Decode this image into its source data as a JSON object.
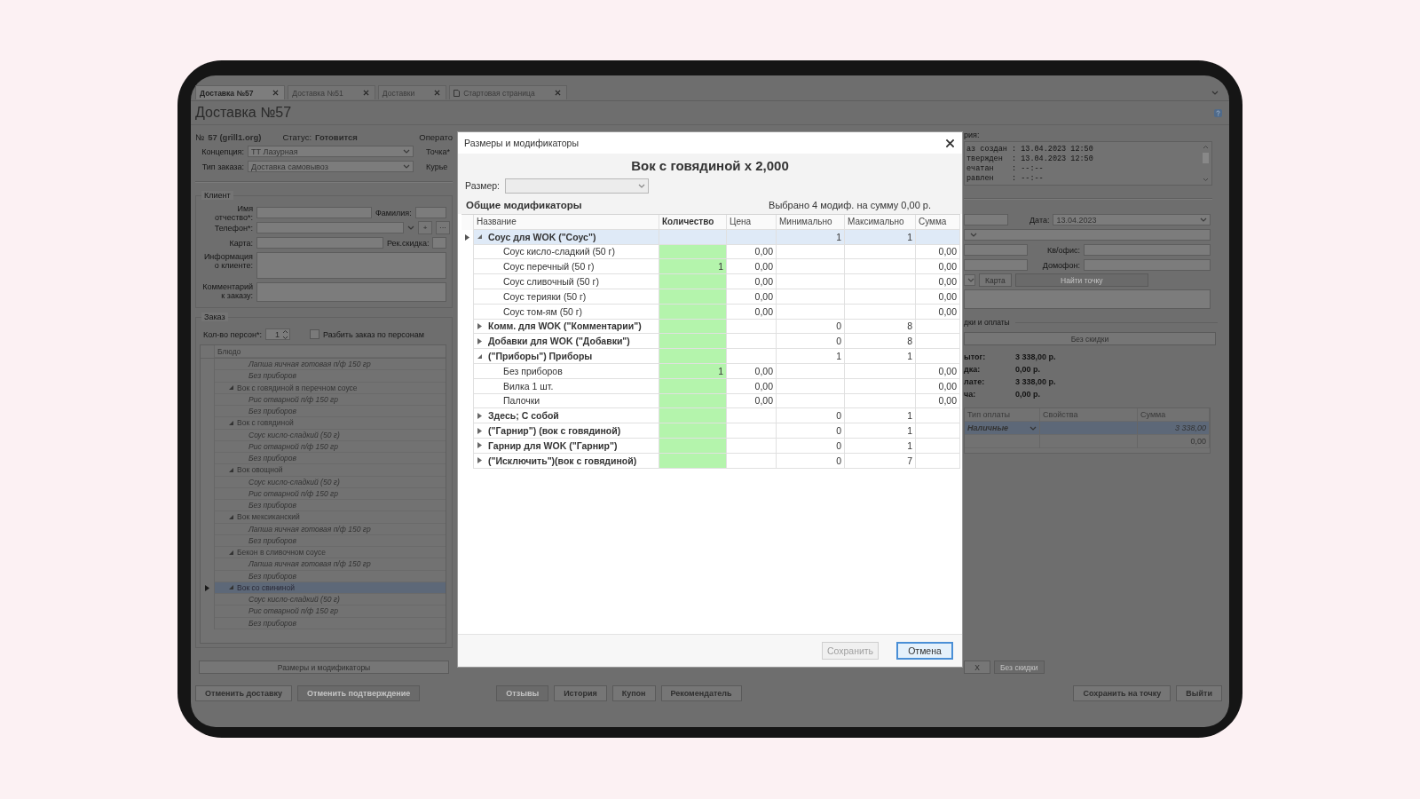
{
  "tabs": [
    {
      "label": "Доставка №57",
      "selected": true,
      "kind": "doc"
    },
    {
      "label": "Доставка №51",
      "selected": false,
      "kind": "doc"
    },
    {
      "label": "Доставки",
      "selected": false,
      "kind": "doc"
    },
    {
      "label": "Стартовая страница",
      "selected": false,
      "kind": "home"
    }
  ],
  "page_title": "Доставка №57",
  "order_header": {
    "number_prefix": "№",
    "number": "57 (grill1.org)",
    "status_label": "Статус:",
    "status": "Готовится",
    "operator_label": "Операто"
  },
  "order_fields": [
    {
      "label": "Концепция:",
      "value": "ТТ Лазурная",
      "side_label": "Точка*"
    },
    {
      "label": "Тип заказа:",
      "value": "Доставка самовывоз",
      "side_label": "Курье"
    }
  ],
  "client": {
    "title": "Клиент",
    "name_label": "Имя отчество*:",
    "surname_label": "Фамилия:",
    "phone_label": "Телефон*:",
    "phone_add": "+",
    "phone_more": "···",
    "card_label": "Карта:",
    "discount_label": "Рек.скидка:",
    "info_label": "Информация о клиенте:",
    "comment_label": "Комментарий к заказу:"
  },
  "order": {
    "title": "Заказ",
    "persons_label": "Кол-во персон*:",
    "persons": "1",
    "split_label": "Разбить заказ по персонам",
    "split_checked": false,
    "column": "Блюдо",
    "dishes": [
      {
        "kind": "modifier",
        "name": "Лапша яичная готовая п/ф 150 гр",
        "selected": false
      },
      {
        "kind": "modifier",
        "name": "Без приборов",
        "selected": false
      },
      {
        "kind": "dish",
        "name": "Вок с говядиной в перечном соусе",
        "expanded": true,
        "selected": false,
        "children": [
          {
            "name": "Рис отварной п/ф 150 гр"
          },
          {
            "name": "Без приборов"
          }
        ]
      },
      {
        "kind": "dish",
        "name": "Вок с говядиной",
        "expanded": true,
        "selected": false,
        "children": [
          {
            "name": "Соус кисло-сладкий (50 г)"
          },
          {
            "name": "Рис отварной п/ф 150 гр"
          },
          {
            "name": "Без приборов"
          }
        ]
      },
      {
        "kind": "dish",
        "name": "Вок овощной",
        "expanded": true,
        "selected": false,
        "children": [
          {
            "name": "Соус кисло-сладкий (50 г)"
          },
          {
            "name": "Рис отварной п/ф 150 гр"
          },
          {
            "name": "Без приборов"
          }
        ]
      },
      {
        "kind": "dish",
        "name": "Вок мексиканский",
        "expanded": true,
        "selected": false,
        "children": [
          {
            "name": "Лапша яичная готовая п/ф 150 гр"
          },
          {
            "name": "Без приборов"
          }
        ]
      },
      {
        "kind": "dish",
        "name": "Бекон в сливочном соусе",
        "expanded": true,
        "selected": false,
        "children": [
          {
            "name": "Лапша яичная готовая п/ф 150 гр"
          },
          {
            "name": "Без приборов"
          }
        ]
      },
      {
        "kind": "dish",
        "name": "Вок со свининой",
        "expanded": true,
        "selected": true,
        "children": [
          {
            "name": "Соус кисло-сладкий (50 г)"
          },
          {
            "name": "Рис отварной п/ф 150 гр"
          },
          {
            "name": "Без приборов"
          }
        ]
      }
    ]
  },
  "sizes_button": "Размеры и модификаторы",
  "right_panel": {
    "history_label": "рия:",
    "history": [
      "аз создан : 13.04.2023 12:50",
      "твержден  : 13.04.2023 12:50",
      "ечатан    : --:--",
      "равлен    : --:--"
    ],
    "date_label": "Дата:",
    "date": "13.04.2023",
    "apt_label": "Кв/офис:",
    "intercom_label": "Домофон:",
    "map_button": "Карта",
    "find_point_button": "Найти точку",
    "find_point_disabled": true,
    "discounts_title": "дки и оплаты",
    "no_discount_button": "Без скидки",
    "totals": [
      {
        "label": "ытог:",
        "value": "3 338,00 р."
      },
      {
        "label": "дка:",
        "value": "0,00 р."
      },
      {
        "label": "лате:",
        "value": "3 338,00 р."
      },
      {
        "label": "ча:",
        "value": "0,00 р."
      }
    ],
    "payment_columns": [
      "Тип оплаты",
      "Свойства",
      "Сумма"
    ],
    "payments": [
      {
        "type": "Наличные",
        "sum": "3 338,00",
        "selected": true
      },
      {
        "sum": "0,00",
        "selected": false
      }
    ],
    "x_button": "Х",
    "discount_button": "Без скидки",
    "discount_disabled": true
  },
  "bottom_buttons": {
    "left": [
      {
        "label": "Отменить доставку",
        "disabled": false
      },
      {
        "label": "Отменить подтверждение",
        "disabled": true
      }
    ],
    "center": [
      {
        "label": "Отзывы",
        "disabled": true
      },
      {
        "label": "История",
        "disabled": false
      },
      {
        "label": "Купон",
        "disabled": false
      },
      {
        "label": "Рекомендатель",
        "disabled": false
      }
    ],
    "right": [
      {
        "label": "Сохранить на точку",
        "disabled": false
      },
      {
        "label": "Выйти",
        "disabled": false
      }
    ]
  },
  "dialog": {
    "title": "Размеры и модификаторы",
    "heading": "Вок с говядиной  x 2,000",
    "size_label": "Размер:",
    "size_disabled": true,
    "section": "Общие модификаторы",
    "summary": "Выбрано 4 модиф. на сумму 0,00 р.",
    "columns": [
      "Название",
      "Количество",
      "Цена",
      "Минимально",
      "Максимально",
      "Сумма"
    ],
    "groups": [
      {
        "name": "Соус для WOK (\"Соус\")",
        "expanded": true,
        "selected": true,
        "min": "1",
        "max": "1",
        "children": [
          {
            "name": "Соус кисло-сладкий (50 г)",
            "price": "0,00",
            "sum": "0,00"
          },
          {
            "name": "Соус перечный (50 г)",
            "quantity": "1",
            "price": "0,00",
            "sum": "0,00"
          },
          {
            "name": "Соус сливочный (50 г)",
            "price": "0,00",
            "sum": "0,00"
          },
          {
            "name": "Соус терияки (50 г)",
            "price": "0,00",
            "sum": "0,00"
          },
          {
            "name": "Соус том-ям (50 г)",
            "price": "0,00",
            "sum": "0,00"
          }
        ]
      },
      {
        "name": "Комм. для WOK (\"Комментарии\")",
        "expanded": false,
        "selected": false,
        "min": "0",
        "max": "8"
      },
      {
        "name": "Добавки для WOK (\"Добавки\")",
        "expanded": false,
        "selected": false,
        "min": "0",
        "max": "8"
      },
      {
        "name": "(\"Приборы\") Приборы",
        "expanded": true,
        "selected": false,
        "min": "1",
        "max": "1",
        "children": [
          {
            "name": "Без приборов",
            "quantity": "1",
            "price": "0,00",
            "sum": "0,00"
          },
          {
            "name": "Вилка 1 шт.",
            "price": "0,00",
            "sum": "0,00"
          },
          {
            "name": "Палочки",
            "price": "0,00",
            "sum": "0,00"
          }
        ]
      },
      {
        "name": "Здесь; С собой",
        "expanded": false,
        "selected": false,
        "min": "0",
        "max": "1"
      },
      {
        "name": "(\"Гарнир\") (вок с говядиной)",
        "expanded": false,
        "selected": false,
        "min": "0",
        "max": "1"
      },
      {
        "name": "Гарнир для WOK (\"Гарнир\")",
        "expanded": false,
        "selected": false,
        "min": "0",
        "max": "1"
      },
      {
        "name": "(\"Исключить\")(вок с говядиной)",
        "expanded": false,
        "selected": false,
        "min": "0",
        "max": "7"
      }
    ],
    "buttons": [
      {
        "label": "Сохранить",
        "disabled": true,
        "default": false
      },
      {
        "label": "Отмена",
        "disabled": false,
        "default": true
      }
    ]
  }
}
